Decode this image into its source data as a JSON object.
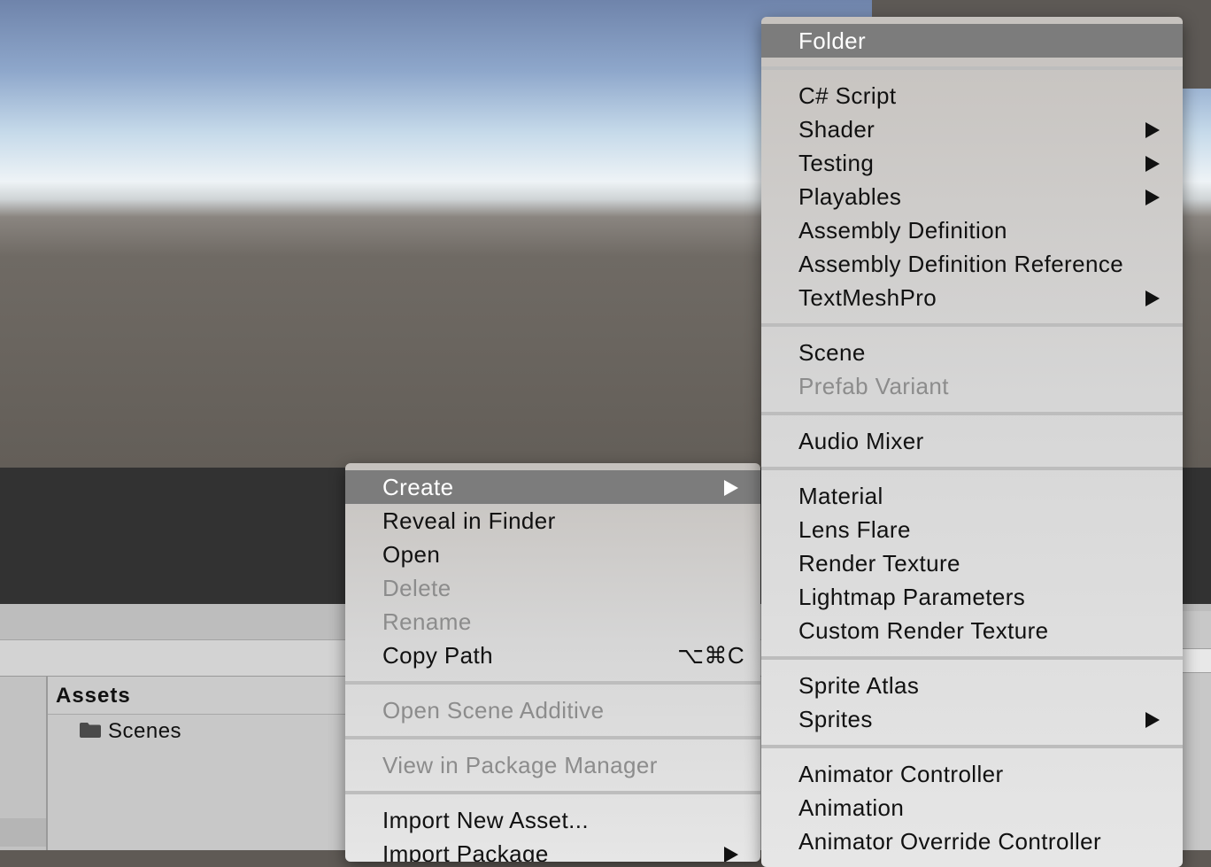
{
  "project": {
    "assets_title": "Assets",
    "folder_name": "Scenes"
  },
  "context_menu": {
    "items": [
      {
        "label": "Create",
        "submenu": true,
        "state": "highlighted"
      },
      {
        "label": "Reveal in Finder"
      },
      {
        "label": "Open"
      },
      {
        "label": "Delete",
        "state": "disabled"
      },
      {
        "label": "Rename",
        "state": "disabled"
      },
      {
        "label": "Copy Path",
        "shortcut": "⌥⌘C"
      },
      {
        "label": "Open Scene Additive",
        "state": "disabled"
      },
      {
        "label": "View in Package Manager",
        "state": "disabled"
      },
      {
        "label": "Import New Asset..."
      },
      {
        "label": "Import Package",
        "submenu": true
      }
    ]
  },
  "create_menu": {
    "items": [
      {
        "label": "Folder",
        "state": "highlighted"
      },
      {
        "label": "C# Script"
      },
      {
        "label": "Shader",
        "submenu": true
      },
      {
        "label": "Testing",
        "submenu": true
      },
      {
        "label": "Playables",
        "submenu": true
      },
      {
        "label": "Assembly Definition"
      },
      {
        "label": "Assembly Definition Reference"
      },
      {
        "label": "TextMeshPro",
        "submenu": true
      },
      {
        "label": "Scene"
      },
      {
        "label": "Prefab Variant",
        "state": "disabled"
      },
      {
        "label": "Audio Mixer"
      },
      {
        "label": "Material"
      },
      {
        "label": "Lens Flare"
      },
      {
        "label": "Render Texture"
      },
      {
        "label": "Lightmap Parameters"
      },
      {
        "label": "Custom Render Texture"
      },
      {
        "label": "Sprite Atlas"
      },
      {
        "label": "Sprites",
        "submenu": true
      },
      {
        "label": "Animator Controller"
      },
      {
        "label": "Animation"
      },
      {
        "label": "Animator Override Controller"
      }
    ]
  },
  "icons": {
    "submenu_arrow": "triangle-right-icon",
    "folder": "folder-icon"
  },
  "colors": {
    "highlight": "#7c7c7c",
    "disabled_text": "#8c8c8c"
  }
}
